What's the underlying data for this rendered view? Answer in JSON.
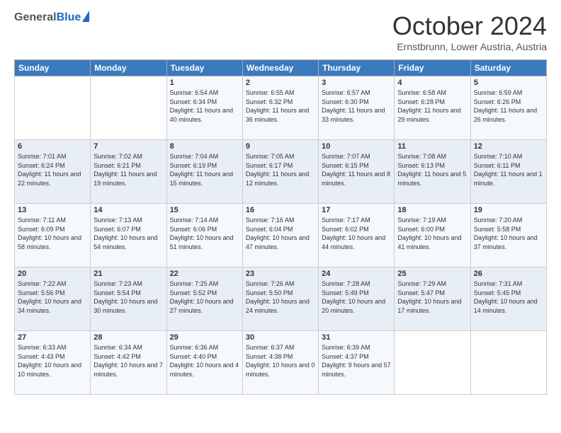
{
  "header": {
    "logo_general": "General",
    "logo_blue": "Blue",
    "title": "October 2024",
    "subtitle": "Ernstbrunn, Lower Austria, Austria"
  },
  "columns": [
    "Sunday",
    "Monday",
    "Tuesday",
    "Wednesday",
    "Thursday",
    "Friday",
    "Saturday"
  ],
  "weeks": [
    [
      {
        "day": "",
        "content": ""
      },
      {
        "day": "",
        "content": ""
      },
      {
        "day": "1",
        "content": "Sunrise: 6:54 AM\nSunset: 6:34 PM\nDaylight: 11 hours and 40 minutes."
      },
      {
        "day": "2",
        "content": "Sunrise: 6:55 AM\nSunset: 6:32 PM\nDaylight: 11 hours and 36 minutes."
      },
      {
        "day": "3",
        "content": "Sunrise: 6:57 AM\nSunset: 6:30 PM\nDaylight: 11 hours and 33 minutes."
      },
      {
        "day": "4",
        "content": "Sunrise: 6:58 AM\nSunset: 6:28 PM\nDaylight: 11 hours and 29 minutes."
      },
      {
        "day": "5",
        "content": "Sunrise: 6:59 AM\nSunset: 6:26 PM\nDaylight: 11 hours and 26 minutes."
      }
    ],
    [
      {
        "day": "6",
        "content": "Sunrise: 7:01 AM\nSunset: 6:24 PM\nDaylight: 11 hours and 22 minutes."
      },
      {
        "day": "7",
        "content": "Sunrise: 7:02 AM\nSunset: 6:21 PM\nDaylight: 11 hours and 19 minutes."
      },
      {
        "day": "8",
        "content": "Sunrise: 7:04 AM\nSunset: 6:19 PM\nDaylight: 11 hours and 15 minutes."
      },
      {
        "day": "9",
        "content": "Sunrise: 7:05 AM\nSunset: 6:17 PM\nDaylight: 11 hours and 12 minutes."
      },
      {
        "day": "10",
        "content": "Sunrise: 7:07 AM\nSunset: 6:15 PM\nDaylight: 11 hours and 8 minutes."
      },
      {
        "day": "11",
        "content": "Sunrise: 7:08 AM\nSunset: 6:13 PM\nDaylight: 11 hours and 5 minutes."
      },
      {
        "day": "12",
        "content": "Sunrise: 7:10 AM\nSunset: 6:11 PM\nDaylight: 11 hours and 1 minute."
      }
    ],
    [
      {
        "day": "13",
        "content": "Sunrise: 7:11 AM\nSunset: 6:09 PM\nDaylight: 10 hours and 58 minutes."
      },
      {
        "day": "14",
        "content": "Sunrise: 7:13 AM\nSunset: 6:07 PM\nDaylight: 10 hours and 54 minutes."
      },
      {
        "day": "15",
        "content": "Sunrise: 7:14 AM\nSunset: 6:06 PM\nDaylight: 10 hours and 51 minutes."
      },
      {
        "day": "16",
        "content": "Sunrise: 7:16 AM\nSunset: 6:04 PM\nDaylight: 10 hours and 47 minutes."
      },
      {
        "day": "17",
        "content": "Sunrise: 7:17 AM\nSunset: 6:02 PM\nDaylight: 10 hours and 44 minutes."
      },
      {
        "day": "18",
        "content": "Sunrise: 7:19 AM\nSunset: 6:00 PM\nDaylight: 10 hours and 41 minutes."
      },
      {
        "day": "19",
        "content": "Sunrise: 7:20 AM\nSunset: 5:58 PM\nDaylight: 10 hours and 37 minutes."
      }
    ],
    [
      {
        "day": "20",
        "content": "Sunrise: 7:22 AM\nSunset: 5:56 PM\nDaylight: 10 hours and 34 minutes."
      },
      {
        "day": "21",
        "content": "Sunrise: 7:23 AM\nSunset: 5:54 PM\nDaylight: 10 hours and 30 minutes."
      },
      {
        "day": "22",
        "content": "Sunrise: 7:25 AM\nSunset: 5:52 PM\nDaylight: 10 hours and 27 minutes."
      },
      {
        "day": "23",
        "content": "Sunrise: 7:26 AM\nSunset: 5:50 PM\nDaylight: 10 hours and 24 minutes."
      },
      {
        "day": "24",
        "content": "Sunrise: 7:28 AM\nSunset: 5:49 PM\nDaylight: 10 hours and 20 minutes."
      },
      {
        "day": "25",
        "content": "Sunrise: 7:29 AM\nSunset: 5:47 PM\nDaylight: 10 hours and 17 minutes."
      },
      {
        "day": "26",
        "content": "Sunrise: 7:31 AM\nSunset: 5:45 PM\nDaylight: 10 hours and 14 minutes."
      }
    ],
    [
      {
        "day": "27",
        "content": "Sunrise: 6:33 AM\nSunset: 4:43 PM\nDaylight: 10 hours and 10 minutes."
      },
      {
        "day": "28",
        "content": "Sunrise: 6:34 AM\nSunset: 4:42 PM\nDaylight: 10 hours and 7 minutes."
      },
      {
        "day": "29",
        "content": "Sunrise: 6:36 AM\nSunset: 4:40 PM\nDaylight: 10 hours and 4 minutes."
      },
      {
        "day": "30",
        "content": "Sunrise: 6:37 AM\nSunset: 4:38 PM\nDaylight: 10 hours and 0 minutes."
      },
      {
        "day": "31",
        "content": "Sunrise: 6:39 AM\nSunset: 4:37 PM\nDaylight: 9 hours and 57 minutes."
      },
      {
        "day": "",
        "content": ""
      },
      {
        "day": "",
        "content": ""
      }
    ]
  ]
}
